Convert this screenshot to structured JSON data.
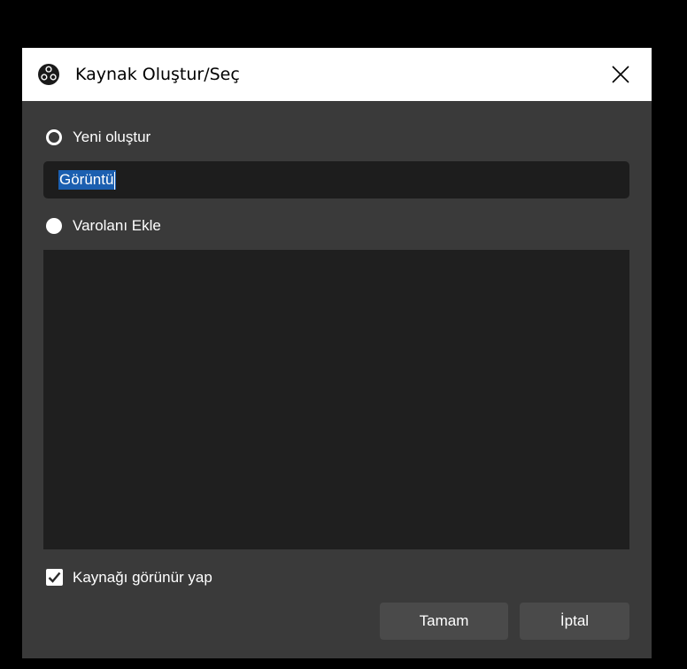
{
  "window": {
    "title": "Kaynak Oluştur/Seç",
    "icon": "obs-logo-icon",
    "close_icon": "close-icon"
  },
  "create_new": {
    "label": "Yeni oluştur",
    "selected": true
  },
  "name_input": {
    "value": "Görüntü",
    "text_selected": true
  },
  "add_existing": {
    "label": "Varolanı Ekle",
    "selected": false
  },
  "existing_sources": [],
  "make_visible": {
    "label": "Kaynağı görünür yap",
    "checked": true
  },
  "buttons": {
    "ok_label": "Tamam",
    "cancel_label": "İptal"
  },
  "colors": {
    "dialog_bg": "#3a3a3a",
    "titlebar_bg": "#ffffff",
    "input_bg": "#1d1d1d",
    "list_bg": "#1f1f1f",
    "selection": "#1b5fb0",
    "button_bg": "#4a4a4a"
  }
}
